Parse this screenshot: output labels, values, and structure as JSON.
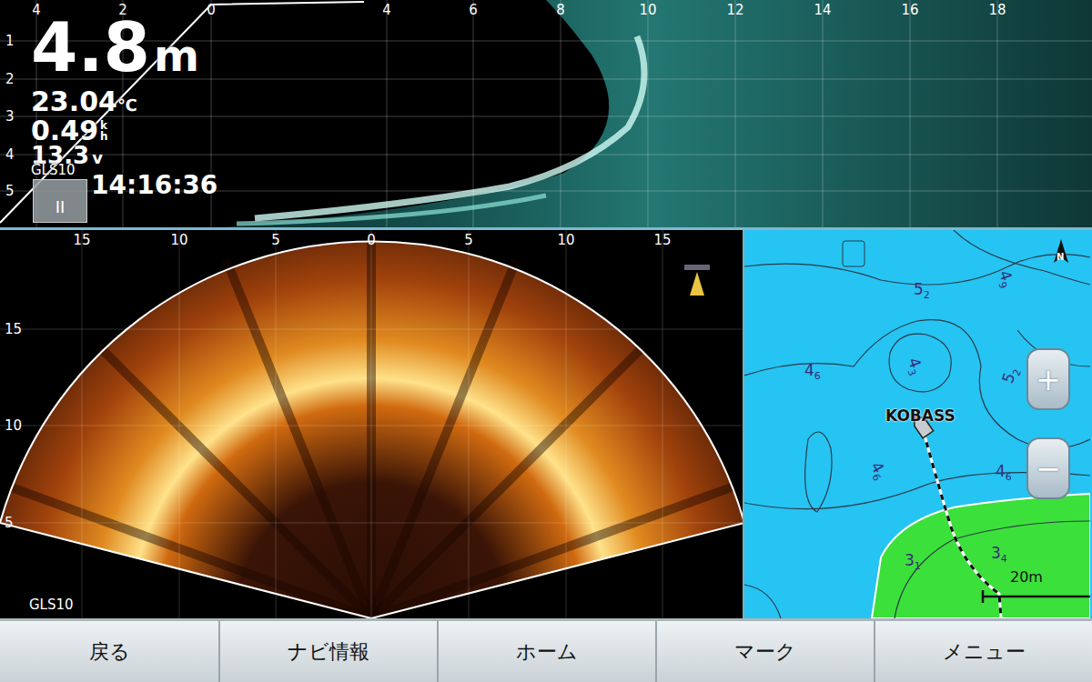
{
  "top_sonar": {
    "axis_x": [
      "4",
      "2",
      "0",
      "4",
      "6",
      "8",
      "10",
      "12",
      "14",
      "16",
      "18"
    ],
    "axis_y": [
      "1",
      "2",
      "3",
      "4",
      "5"
    ],
    "depth": "4.8",
    "depth_unit": "m",
    "temperature": "23.04",
    "temp_unit": "℃",
    "speed": "0.49",
    "speed_unit_top": "k",
    "speed_unit_bottom": "h",
    "voltage": "13.3",
    "voltage_unit": "v",
    "source": "GLS10",
    "time": "14:16:36",
    "pause": "II"
  },
  "fan_sonar": {
    "axis_x": [
      "15",
      "10",
      "5",
      "0",
      "5",
      "10",
      "15"
    ],
    "axis_y": [
      "15",
      "10",
      "5"
    ],
    "source": "GLS10"
  },
  "map": {
    "depth_labels": [
      {
        "main": "5",
        "sub": "2"
      },
      {
        "main": "4",
        "sub": "9"
      },
      {
        "main": "4",
        "sub": "3"
      },
      {
        "main": "4",
        "sub": "6"
      },
      {
        "main": "5",
        "sub": "2"
      },
      {
        "main": "4",
        "sub": "6"
      },
      {
        "main": "4",
        "sub": "6"
      },
      {
        "main": "3",
        "sub": "1"
      },
      {
        "main": "3",
        "sub": "4"
      }
    ],
    "boat_label": "KOBASS",
    "scale": "20m",
    "zoom_in": "+",
    "zoom_out": "−",
    "north": "N"
  },
  "buttons": [
    "戻る",
    "ナビ情報",
    "ホーム",
    "マーク",
    "メニュー"
  ]
}
